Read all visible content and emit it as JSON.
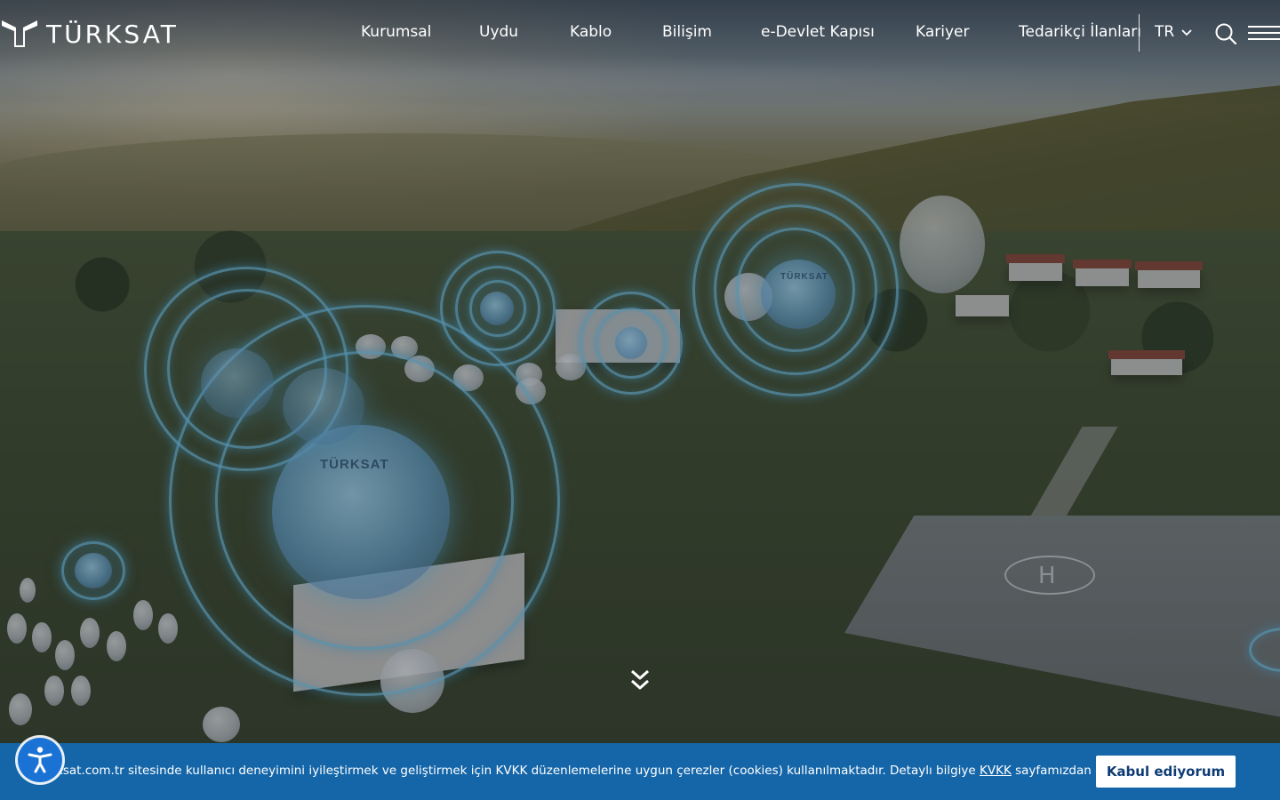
{
  "brand": {
    "name": "TÜRKSAT"
  },
  "nav": {
    "items": [
      {
        "label": "Kurumsal"
      },
      {
        "label": "Uydu"
      },
      {
        "label": "Kablo"
      },
      {
        "label": "Bilişim"
      },
      {
        "label": "e-Devlet Kapısı"
      },
      {
        "label": "Kariyer"
      },
      {
        "label": "Tedarikçi İlanları"
      }
    ],
    "language": "TR",
    "icons": {
      "search": "search-icon",
      "menu": "hamburger-menu-icon",
      "language": "chevron-down-icon"
    }
  },
  "hero": {
    "dish_labels": [
      "TÜRKSAT",
      "TÜRKSAT"
    ],
    "scroll_icon": "double-chevron-down-icon"
  },
  "cookie": {
    "text_before": "ksat.com.tr sitesinde kullanıcı deneyimini iyileştirmek ve geliştirmek için KVKK düzenlemelerine uygun çerezler (cookies) kullanılmaktadır. Detaylı bilgiye ",
    "link_label": "KVKK",
    "text_after": " sayfamızdan erişebilirsiniz.",
    "accept_label": "Kabul ediyorum",
    "accessibility_icon": "accessibility-icon"
  },
  "colors": {
    "cookie_bar": "#1566a8",
    "accept_text": "#0d3c75",
    "accessibility_button": "#1a73d4",
    "ring_glow": "#78cdf0"
  }
}
